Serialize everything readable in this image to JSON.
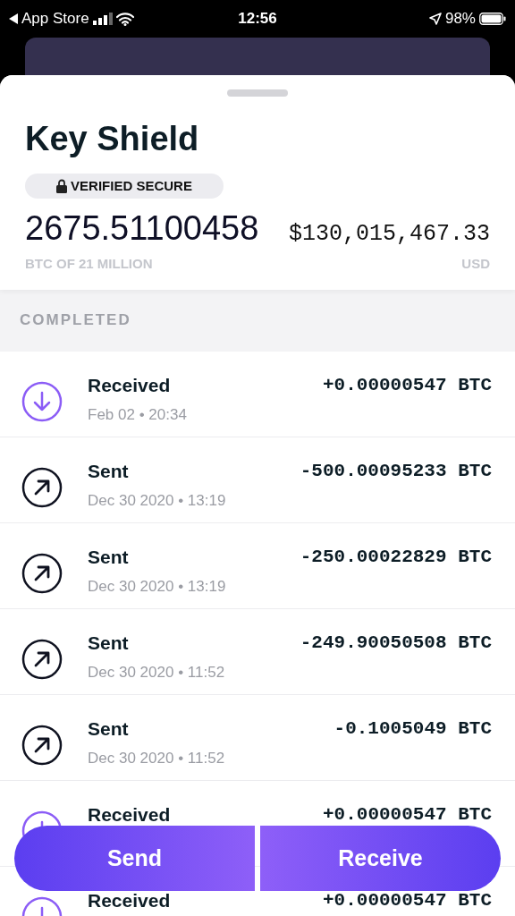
{
  "status_bar": {
    "back_label": "App Store",
    "time": "12:56",
    "battery": "98%"
  },
  "wallet": {
    "title": "Key Shield",
    "badge": "VERIFIED SECURE",
    "btc_amount": "2675.51100458",
    "btc_caption": "BTC OF 21 MILLION",
    "usd_amount": "$130,015,467.33",
    "usd_caption": "USD"
  },
  "section_header": "COMPLETED",
  "transactions": [
    {
      "kind": "received",
      "title": "Received",
      "date": "Feb 02 • 20:34",
      "amount": "+0.00000547 BTC"
    },
    {
      "kind": "sent",
      "title": "Sent",
      "date": "Dec 30 2020 • 13:19",
      "amount": "-500.00095233 BTC"
    },
    {
      "kind": "sent",
      "title": "Sent",
      "date": "Dec 30 2020 • 13:19",
      "amount": "-250.00022829 BTC"
    },
    {
      "kind": "sent",
      "title": "Sent",
      "date": "Dec 30 2020 • 11:52",
      "amount": "-249.90050508 BTC"
    },
    {
      "kind": "sent",
      "title": "Sent",
      "date": "Dec 30 2020 • 11:52",
      "amount": "-0.1005049 BTC"
    },
    {
      "kind": "received",
      "title": "Received",
      "amount": "+0.00000547 BTC"
    },
    {
      "kind": "received",
      "title": "Received",
      "amount": "+0.00000547 BTC"
    }
  ],
  "actions": [
    "Send",
    "Receive"
  ]
}
